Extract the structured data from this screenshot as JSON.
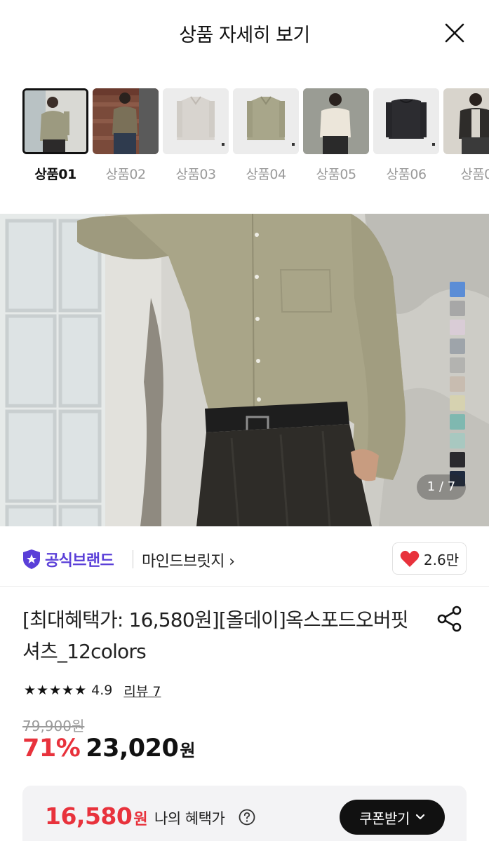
{
  "header": {
    "title": "상품 자세히 보기"
  },
  "thumbnails": [
    {
      "label": "상품01",
      "active": true
    },
    {
      "label": "상품02",
      "active": false
    },
    {
      "label": "상품03",
      "active": false
    },
    {
      "label": "상품04",
      "active": false
    },
    {
      "label": "상품05",
      "active": false
    },
    {
      "label": "상품06",
      "active": false
    },
    {
      "label": "상품0",
      "active": false
    }
  ],
  "gallery": {
    "counter": "1 / 7",
    "swatch_colors": [
      "#5b8dd6",
      "#a7a7a7",
      "#d9ccd6",
      "#9ea4aa",
      "#b3b3b0",
      "#c8bcb0",
      "#d6d2b0",
      "#7fb8b0",
      "#a8c8c0",
      "#2a2a2e",
      "#1e2a3e"
    ]
  },
  "brand": {
    "badge_label": "공식브랜드",
    "name": "마인드브릿지 ›",
    "likes": "2.6만",
    "accent": "#5a3fd8"
  },
  "product": {
    "title": "[최대혜택가: 16,580원][올데이]옥스포드오버핏셔츠_12colors",
    "stars": "★★★★★",
    "rating": "4.9",
    "review_link": "리뷰 7",
    "original_price": "79,900원",
    "discount": "71%",
    "sale_price": "23,020",
    "sale_unit": "원"
  },
  "benefit": {
    "price": "16,580",
    "unit": "원",
    "label": "나의 혜택가",
    "coupon_button": "쿠폰받기"
  },
  "colors": {
    "discount_red": "#e8323c",
    "heart_red": "#e8323c"
  }
}
